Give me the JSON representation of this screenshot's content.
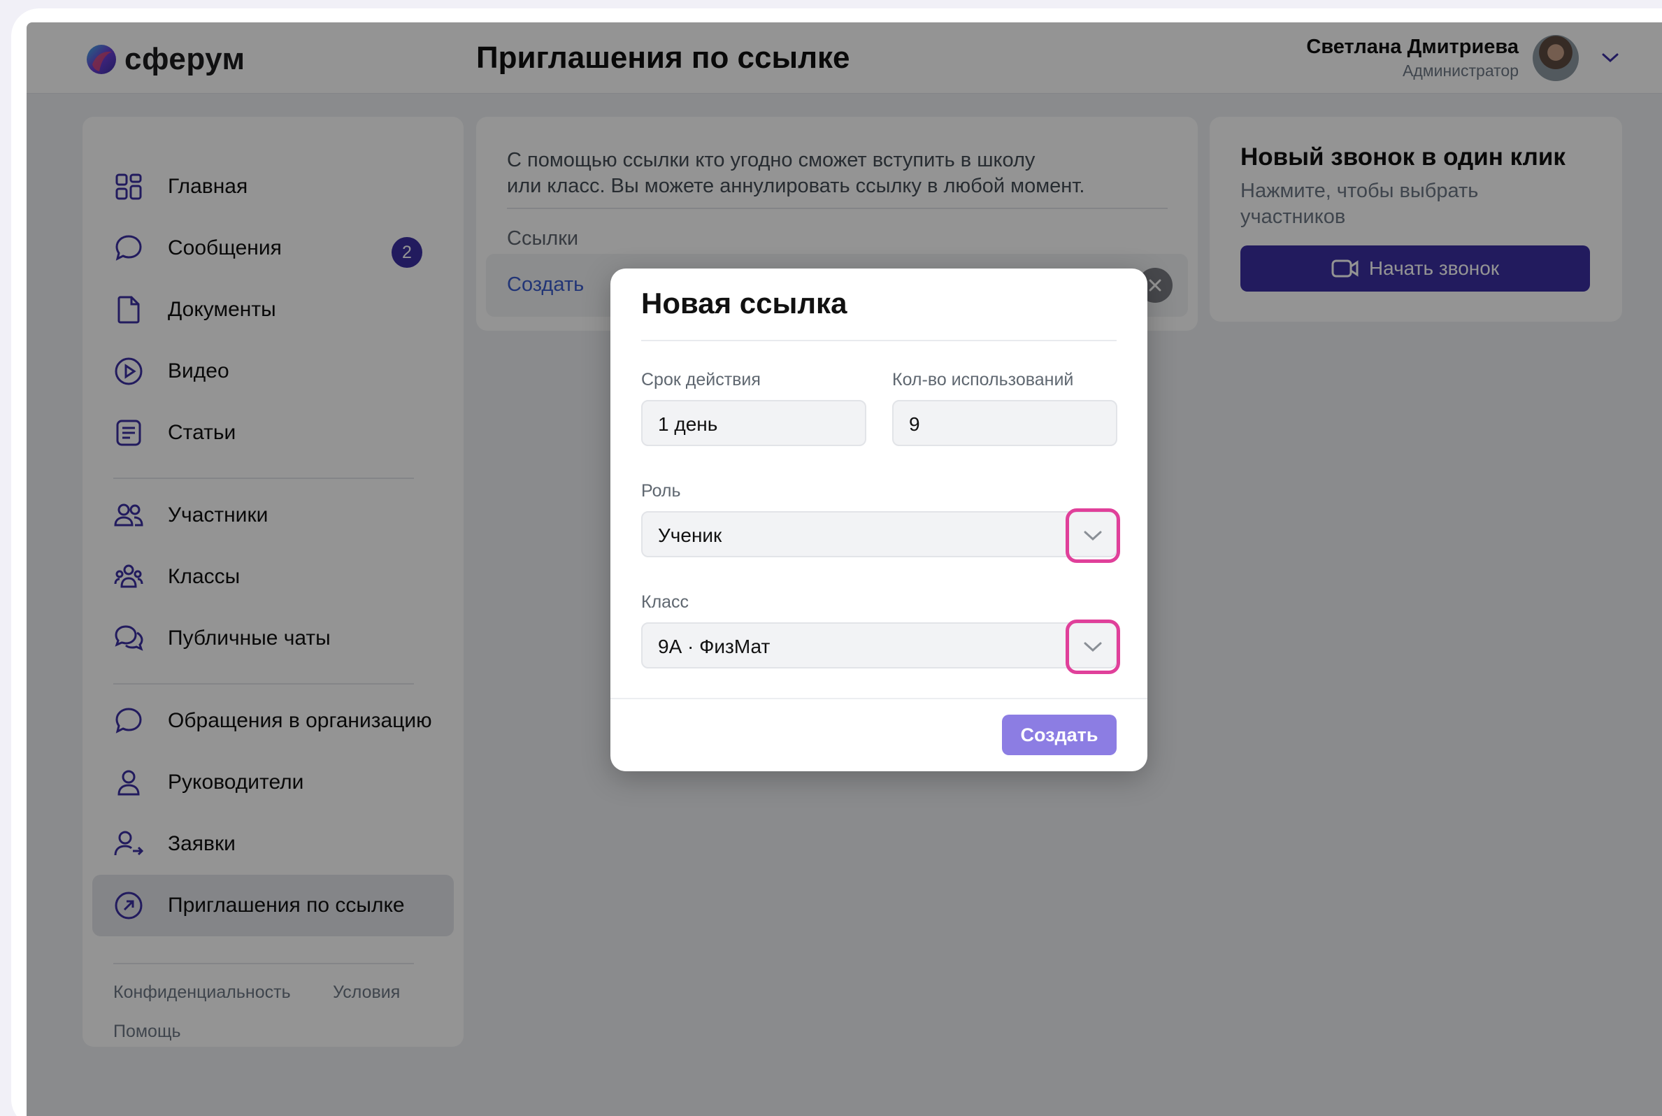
{
  "app": {
    "logo_text": "сферум",
    "page_title": "Приглашения по ссылке"
  },
  "user": {
    "name": "Светлана Дмитриева",
    "role": "Администратор"
  },
  "sidebar": {
    "items": [
      {
        "label": "Главная",
        "icon": "home-grid-icon"
      },
      {
        "label": "Сообщения",
        "icon": "message-icon",
        "badge": "2"
      },
      {
        "label": "Документы",
        "icon": "document-icon"
      },
      {
        "label": "Видео",
        "icon": "play-icon"
      },
      {
        "label": "Статьи",
        "icon": "article-icon"
      },
      {
        "label": "Участники",
        "icon": "users-icon"
      },
      {
        "label": "Классы",
        "icon": "classes-icon"
      },
      {
        "label": "Публичные чаты",
        "icon": "chats-icon"
      },
      {
        "label": "Обращения в организацию",
        "icon": "message-icon"
      },
      {
        "label": "Руководители",
        "icon": "user-icon"
      },
      {
        "label": "Заявки",
        "icon": "user-request-icon"
      },
      {
        "label": "Приглашения по ссылке",
        "icon": "link-arrow-icon",
        "active": true
      }
    ],
    "footer": {
      "privacy": "Конфиденциальность",
      "terms": "Условия",
      "help": "Помощь"
    }
  },
  "info_card": {
    "text_line1": "С помощью ссылки кто угодно сможет вступить в школу",
    "text_line2": "или класс. Вы можете аннулировать ссылку в любой момент.",
    "links_label": "Ссылки",
    "create_link": "Создать"
  },
  "call_card": {
    "title": "Новый звонок в один клик",
    "subtitle_line1": "Нажмите, чтобы выбрать",
    "subtitle_line2": "участников",
    "button": "Начать звонок"
  },
  "modal": {
    "title": "Новая ссылка",
    "validity_label": "Срок  действия",
    "validity_value": "1 день",
    "uses_label": "Кол-во использований",
    "uses_value": "9",
    "role_label": "Роль",
    "role_value": "Ученик",
    "class_label": "Класс",
    "class_value": "9А · ФизМат",
    "create_button": "Создать"
  },
  "colors": {
    "brand": "#3b2fa3",
    "highlight": "#e0409a",
    "create_button": "#8c7de3"
  }
}
